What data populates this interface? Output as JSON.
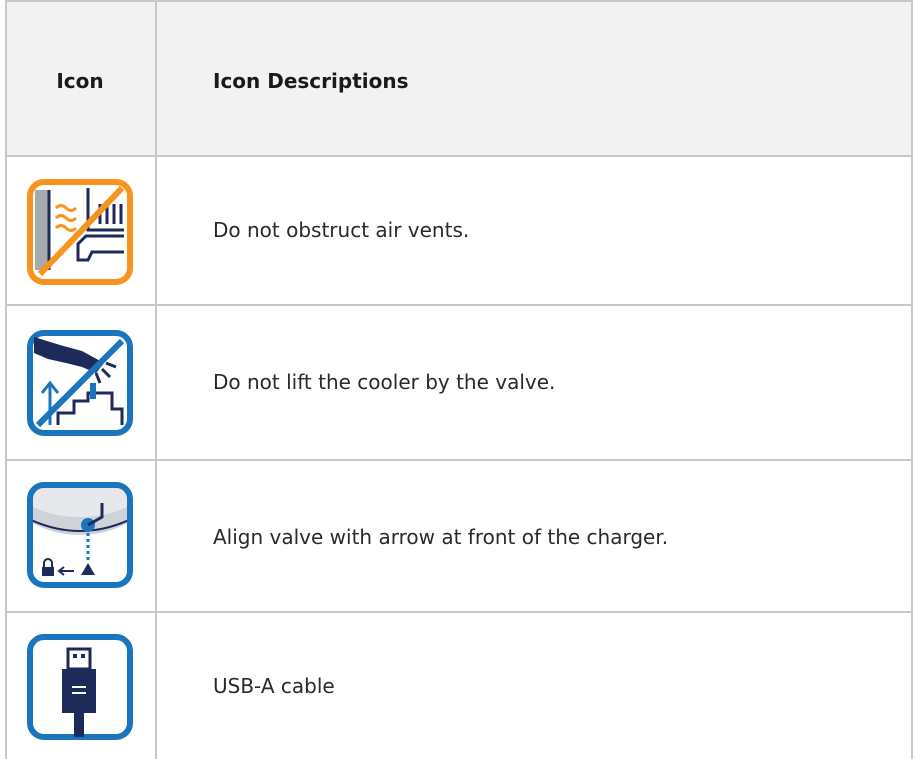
{
  "table": {
    "headers": {
      "icon": "Icon",
      "description": "Icon Descriptions"
    },
    "rows": [
      {
        "icon": "do-not-obstruct-vents-icon",
        "color": "#f7941d",
        "description": "Do not obstruct air vents."
      },
      {
        "icon": "do-not-lift-by-valve-icon",
        "color": "#1a75bc",
        "description": "Do not lift the cooler by the valve."
      },
      {
        "icon": "align-valve-arrow-icon",
        "color": "#1a75bc",
        "description": "Align valve with arrow at front of the charger."
      },
      {
        "icon": "usb-a-cable-icon",
        "color": "#1a75bc",
        "description": "USB-A cable"
      }
    ]
  }
}
